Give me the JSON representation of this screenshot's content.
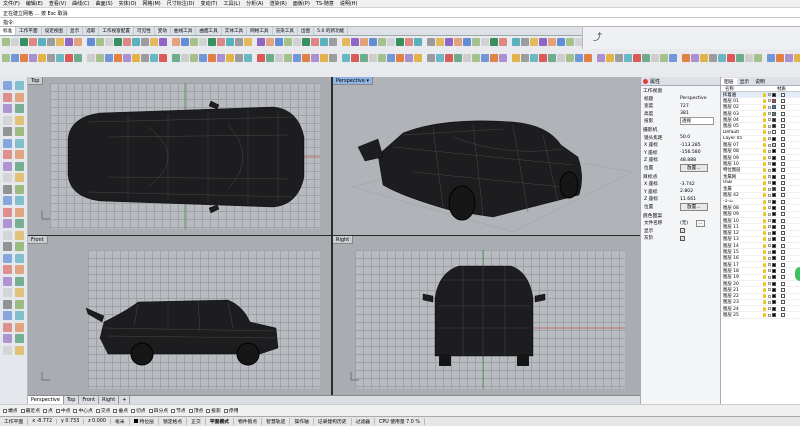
{
  "menu": [
    "文件(F)",
    "编辑(E)",
    "查看(V)",
    "曲线(C)",
    "曲面(S)",
    "实体(O)",
    "网格(M)",
    "尺寸标注(D)",
    "变动(T)",
    "工具(L)",
    "分析(A)",
    "渲染(R)",
    "面板(P)",
    "TS-随意",
    "说明(H)"
  ],
  "command_history": "正在建立网格 ... 按 Esc 取消",
  "command_prompt": "指令:",
  "toolbar_tabs": [
    "标准",
    "工作平面",
    "设定视图",
    "显示",
    "选取",
    "工作视窗配置",
    "可见性",
    "变动",
    "曲线工具",
    "曲面工具",
    "实体工具",
    "网格工具",
    "渲染工具",
    "出图",
    "5.0 的新功能"
  ],
  "viewports": {
    "top": {
      "title": "Top"
    },
    "perspective": {
      "title": "Perspective"
    },
    "front": {
      "title": "Front"
    },
    "right": {
      "title": "Right"
    }
  },
  "viewport_tabs": [
    "Perspective",
    "Top",
    "Front",
    "Right"
  ],
  "viewport_tab_add": "+",
  "properties": {
    "tab": "属性",
    "section_viewport": "工作视窗",
    "title_k": "标题",
    "title_v": "Perspective",
    "width_k": "宽度",
    "width_v": "727",
    "height_k": "高度",
    "height_v": "381",
    "proj_k": "投影",
    "proj_v": "透视",
    "section_camera": "摄影机",
    "lens_k": "镜头焦距",
    "lens_v": "50.0",
    "cx_k": "X 座标",
    "cx_v": "-113.285",
    "cy_k": "Y 座标",
    "cy_v": "-156.580",
    "cz_k": "Z 座标",
    "cz_v": "48.888",
    "pos_k": "位置",
    "pos_btn": "放置...",
    "section_target": "目标点",
    "tx_k": "X 座标",
    "tx_v": "-3.742",
    "ty_k": "Y 座标",
    "ty_v": "2.802",
    "tz_k": "Z 座标",
    "tz_v": "11.661",
    "tpos_k": "位置",
    "tpos_btn": "放置...",
    "section_bg": "底色图案",
    "file_k": "文件名称",
    "file_v": "(无)",
    "show_k": "显示",
    "gray_k": "灰阶"
  },
  "layers": {
    "tabs": [
      "图层",
      "显示",
      "说明"
    ],
    "col_name": "名称",
    "col_material": "材质",
    "items": [
      "挥着遍",
      "图层 01",
      "图层 02",
      "图层 03",
      "图层 04",
      "图层 05",
      "Default",
      "Layer 05",
      "图层 07",
      "图层 08",
      "图层 09",
      "图层 10",
      "特位图层",
      "金属网",
      "USB",
      "金属",
      "图层 42",
      "-ٹ-1",
      "图层 08",
      "图层 09",
      "图层 10",
      "图层 11",
      "图层 12",
      "图层 13",
      "图层 14",
      "图层 15",
      "图层 16",
      "图层 17",
      "图层 18",
      "图层 19",
      "图层 20",
      "图层 21",
      "图层 22",
      "图层 23",
      "图层 24",
      "图层 25"
    ],
    "swatches": [
      "#000000",
      "#e53935",
      "#1e88e5",
      "#43a047",
      "#222222",
      "#111111",
      "#ffffff",
      "#000000",
      "#cccccc",
      "#000000",
      "#000000",
      "#000000",
      "#000000",
      "#000000",
      "#000000",
      "#333333",
      "#000000",
      "#000000",
      "#000000",
      "#000000",
      "#000000",
      "#000000",
      "#000000",
      "#000000",
      "#000000",
      "#000000",
      "#000000",
      "#000000",
      "#000000",
      "#000000",
      "#000000",
      "#000000",
      "#000000",
      "#000000",
      "#000000",
      "#000000"
    ]
  },
  "osnaps": [
    "端点",
    "最近点",
    "点",
    "中点",
    "中心点",
    "交点",
    "垂点",
    "切点",
    "四分点",
    "节点",
    "顶点",
    "投影",
    "停用"
  ],
  "status": {
    "cplane": "工作平面",
    "x": "x -8.772",
    "y": "y 0.733",
    "z": "z 0.000",
    "unit": "毫米",
    "layer": "特位层",
    "grid_snap": "锁定格点",
    "ortho": "正交",
    "planar": "平面模式",
    "osnap": "物件锁点",
    "smarttrack": "智慧轨迹",
    "gumball": "操作轴",
    "history": "记录建构历史",
    "filter": "过滤器",
    "cpu": "CPU 使用量 7.0 %"
  },
  "colors": {
    "accent": "#8fb4e3",
    "viewport_bg": "#a9adb2",
    "grid": "#9ea2a7"
  }
}
